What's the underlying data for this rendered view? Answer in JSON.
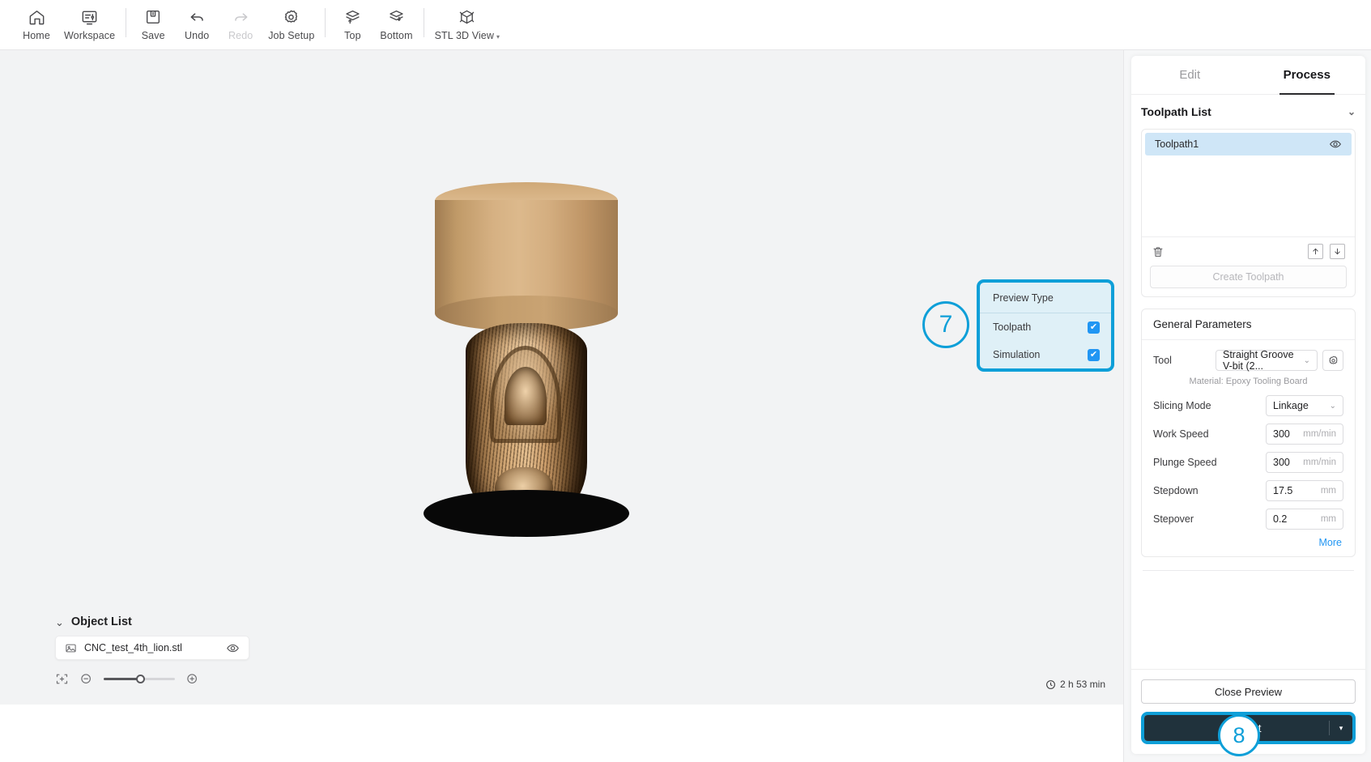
{
  "toolbar": {
    "items": [
      {
        "label": "Home",
        "icon": "home-icon",
        "disabled": false
      },
      {
        "label": "Workspace",
        "icon": "workspace-icon",
        "disabled": false
      },
      {
        "label": "Save",
        "icon": "save-icon",
        "disabled": false
      },
      {
        "label": "Undo",
        "icon": "undo-icon",
        "disabled": false
      },
      {
        "label": "Redo",
        "icon": "redo-icon",
        "disabled": true
      },
      {
        "label": "Job Setup",
        "icon": "gear-icon",
        "disabled": false
      },
      {
        "label": "Top",
        "icon": "layers-up-icon",
        "disabled": false
      },
      {
        "label": "Bottom",
        "icon": "layers-down-icon",
        "disabled": false
      },
      {
        "label": "STL 3D View",
        "icon": "cube-view-icon",
        "disabled": false,
        "caret": "▾"
      }
    ]
  },
  "canvas": {
    "object_list": {
      "title": "Object List",
      "chevron": "⌄",
      "items": [
        {
          "name": "CNC_test_4th_lion.stl",
          "thumb_icon": "image-icon",
          "visibility_icon": "eye-icon"
        }
      ]
    },
    "zoom_bar": {
      "fit_icon": "fit-to-screen-icon",
      "zoom_out_icon": "zoom-out-icon",
      "zoom_in_icon": "zoom-in-icon"
    },
    "time_estimate": {
      "icon": "clock-icon",
      "text": "2 h 53 min"
    }
  },
  "preview_type": {
    "title": "Preview Type",
    "rows": [
      {
        "label": "Toolpath",
        "checked": true,
        "check_glyph": "✔"
      },
      {
        "label": "Simulation",
        "checked": true,
        "check_glyph": "✔"
      }
    ],
    "callout": "7"
  },
  "right_panel": {
    "tabs": [
      {
        "label": "Edit",
        "active": false
      },
      {
        "label": "Process",
        "active": true
      }
    ],
    "toolpath_list": {
      "title": "Toolpath List",
      "chevron": "⌄",
      "items": [
        {
          "name": "Toolpath1",
          "visibility_icon": "eye-icon"
        }
      ],
      "actions": {
        "delete_icon": "trash-icon",
        "move_up_icon": "arrow-up-icon",
        "move_down_icon": "arrow-down-icon"
      },
      "create_button": "Create Toolpath"
    },
    "general_parameters": {
      "title": "General Parameters",
      "tool": {
        "label": "Tool",
        "value": "Straight Groove V-bit (2...",
        "caret": "⌄",
        "settings_icon": "gear-icon"
      },
      "material_note": "Material: Epoxy Tooling Board",
      "fields": [
        {
          "label": "Slicing Mode",
          "value": "Linkage",
          "unit": "",
          "type": "select",
          "caret": "⌄"
        },
        {
          "label": "Work Speed",
          "value": "300",
          "unit": "mm/min",
          "type": "number"
        },
        {
          "label": "Plunge Speed",
          "value": "300",
          "unit": "mm/min",
          "type": "number"
        },
        {
          "label": "Stepdown",
          "value": "17.5",
          "unit": "mm",
          "type": "number"
        },
        {
          "label": "Stepover",
          "value": "0.2",
          "unit": "mm",
          "type": "number"
        }
      ],
      "more_link": "More"
    },
    "footer": {
      "close_preview": "Close Preview",
      "export": "Export",
      "export_caret": "▾",
      "callout": "8"
    }
  },
  "colors": {
    "accent_blue": "#0e9fd8",
    "checkbox_blue": "#2196f3",
    "link_blue": "#2196f3",
    "export_dark": "#20323c",
    "canvas_bg": "#f2f3f4",
    "selection_blue": "#cfe6f7"
  }
}
